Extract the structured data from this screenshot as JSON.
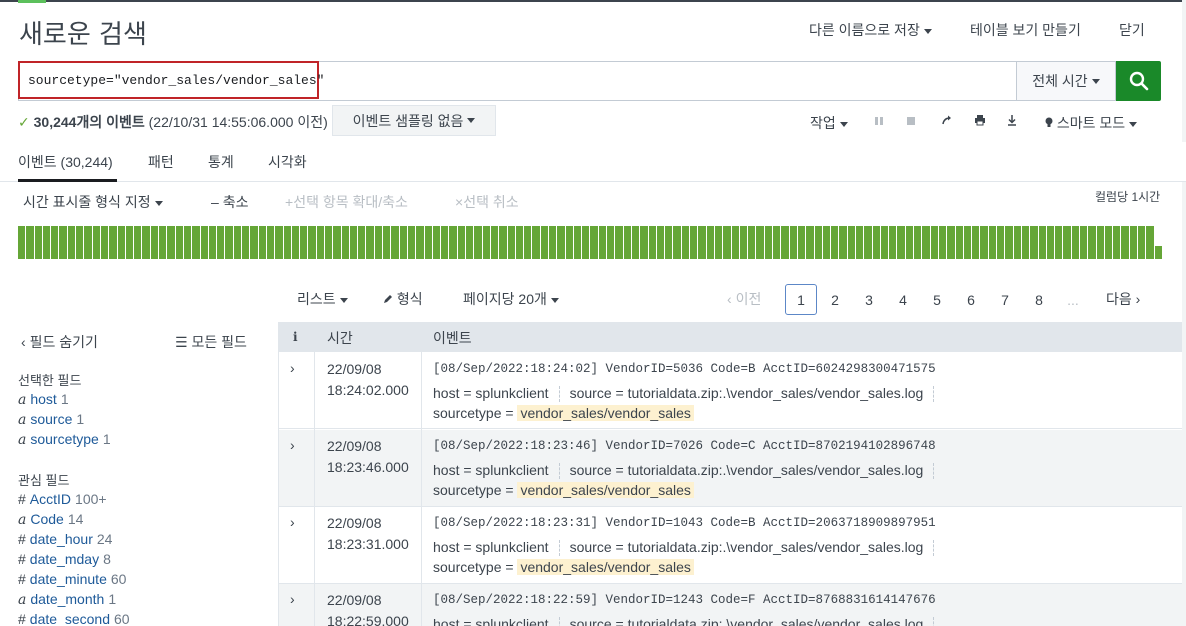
{
  "header": {
    "title": "새로운 검색",
    "save_as": "다른 이름으로 저장",
    "create_table_view": "테이블 보기 만들기",
    "close": "닫기"
  },
  "search": {
    "query": "sourcetype=\"vendor_sales/vendor_sales\"",
    "time_range": "전체 시간"
  },
  "status": {
    "count": "30,244개의 이벤트",
    "detail": "(22/10/31 14:55:06.000 이전)",
    "sampling": "이벤트 샘플링 없음"
  },
  "tools": {
    "job": "작업",
    "mode": "스마트 모드"
  },
  "tabs": [
    {
      "label": "이벤트 (30,244)"
    },
    {
      "label": "패턴"
    },
    {
      "label": "통계"
    },
    {
      "label": "시각화"
    }
  ],
  "timeline": {
    "format": "시간 표시줄 형식 지정",
    "zoom_out": "축소",
    "zoom_selection": "선택 항목 확대/축소",
    "deselect": "선택 취소",
    "per_column": "컬럼당 1시간"
  },
  "results_bar": {
    "list": "리스트",
    "format": "형식",
    "per_page": "페이지당 20개",
    "prev": "이전",
    "next": "다음",
    "pages": [
      "1",
      "2",
      "3",
      "4",
      "5",
      "6",
      "7",
      "8",
      "..."
    ]
  },
  "fields_panel": {
    "hide_fields": "필드 숨기기",
    "all_fields": "모든 필드",
    "selected_title": "선택한 필드",
    "selected": [
      {
        "type": "a",
        "name": "host",
        "count": "1"
      },
      {
        "type": "a",
        "name": "source",
        "count": "1"
      },
      {
        "type": "a",
        "name": "sourcetype",
        "count": "1"
      }
    ],
    "interesting_title": "관심 필드",
    "interesting": [
      {
        "type": "#",
        "name": "AcctID",
        "count": "100+"
      },
      {
        "type": "a",
        "name": "Code",
        "count": "14"
      },
      {
        "type": "#",
        "name": "date_hour",
        "count": "24"
      },
      {
        "type": "#",
        "name": "date_mday",
        "count": "8"
      },
      {
        "type": "#",
        "name": "date_minute",
        "count": "60"
      },
      {
        "type": "a",
        "name": "date_month",
        "count": "1"
      },
      {
        "type": "#",
        "name": "date_second",
        "count": "60"
      }
    ]
  },
  "table": {
    "col_info": "i",
    "col_time": "시간",
    "col_event": "이벤트",
    "rows": [
      {
        "date": "22/09/08",
        "time": "18:24:02.000",
        "raw": "[08/Sep/2022:18:24:02] VendorID=5036 Code=B AcctID=6024298300471575",
        "host_label": "host =",
        "host": "splunkclient",
        "source_label": "source =",
        "source": "tutorialdata.zip:.\\vendor_sales/vendor_sales.log",
        "st_label": "sourcetype =",
        "sourcetype": "vendor_sales/vendor_sales"
      },
      {
        "date": "22/09/08",
        "time": "18:23:46.000",
        "raw": "[08/Sep/2022:18:23:46] VendorID=7026 Code=C AcctID=8702194102896748",
        "host_label": "host =",
        "host": "splunkclient",
        "source_label": "source =",
        "source": "tutorialdata.zip:.\\vendor_sales/vendor_sales.log",
        "st_label": "sourcetype =",
        "sourcetype": "vendor_sales/vendor_sales"
      },
      {
        "date": "22/09/08",
        "time": "18:23:31.000",
        "raw": "[08/Sep/2022:18:23:31] VendorID=1043 Code=B AcctID=2063718909897951",
        "host_label": "host =",
        "host": "splunkclient",
        "source_label": "source =",
        "source": "tutorialdata.zip:.\\vendor_sales/vendor_sales.log",
        "st_label": "sourcetype =",
        "sourcetype": "vendor_sales/vendor_sales"
      },
      {
        "date": "22/09/08",
        "time": "18:22:59.000",
        "raw": "[08/Sep/2022:18:22:59] VendorID=1243 Code=F AcctID=8768831614147676",
        "host_label": "host =",
        "host": "splunkclient",
        "source_label": "source =",
        "source": "tutorialdata.zip:.\\vendor_sales/vendor_sales.log"
      }
    ]
  },
  "colors": {
    "accent_green": "#1a8929",
    "histogram_green": "#65a637",
    "query_border_red": "#c02428"
  }
}
